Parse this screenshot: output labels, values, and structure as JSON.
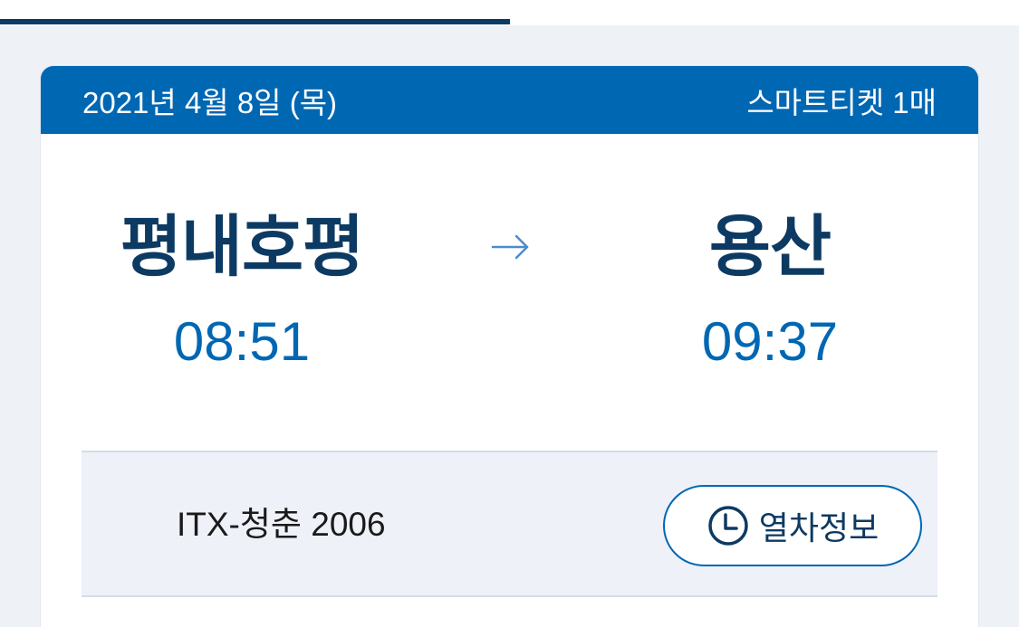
{
  "progress": {
    "fraction": 0.5
  },
  "ticket": {
    "date": "2021년 4월 8일 (목)",
    "ticket_type": "스마트티켓 1매",
    "departure": {
      "station": "평내호평",
      "time": "08:51"
    },
    "arrival": {
      "station": "용산",
      "time": "09:37"
    },
    "train": "ITX-청춘 2006",
    "train_info_button": "열차정보"
  },
  "icons": {
    "route_arrow": "right-arrow-icon",
    "train_info": "clock-icon"
  },
  "colors": {
    "header_blue": "#0067b3",
    "navy": "#0d3a62",
    "time_blue": "#0067b3",
    "page_bg": "#eef1f6"
  }
}
